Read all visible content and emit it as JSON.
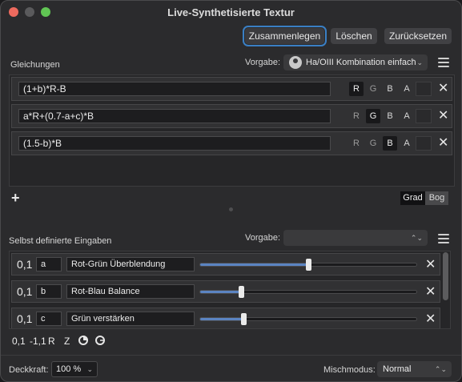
{
  "window": {
    "title": "Live-Synthetisierte Textur"
  },
  "toolbar": {
    "merge_label": "Zusammenlegen",
    "delete_label": "Löschen",
    "reset_label": "Zurücksetzen"
  },
  "equations": {
    "section_label": "Gleichungen",
    "preset_label": "Vorgabe:",
    "preset_value": "Ha/OIII Kombination einfach",
    "channel_labels": [
      "R",
      "G",
      "B",
      "A"
    ],
    "rows": [
      {
        "formula": "(1+b)*R-B",
        "active_channel": "R"
      },
      {
        "formula": "a*R+(0.7-a+c)*B",
        "active_channel": "G"
      },
      {
        "formula": "(1.5-b)*B",
        "active_channel": "B"
      }
    ],
    "angle_units": {
      "degree": "Grad",
      "radian": "Bog",
      "selected": "Grad"
    }
  },
  "inputs": {
    "section_label": "Selbst definierte Eingaben",
    "preset_label": "Vorgabe:",
    "preset_value": "",
    "rows": [
      {
        "value": "0,1",
        "var": "a",
        "name": "Rot-Grün Überblendung",
        "level": 0.5
      },
      {
        "value": "0,1",
        "var": "b",
        "name": "Rot-Blau Balance",
        "level": 0.19
      },
      {
        "value": "0,1",
        "var": "c",
        "name": "Grün verstärken",
        "level": 0.2
      }
    ],
    "add_tools": {
      "unit": "0,1",
      "signed": "-1,1",
      "rotation": "R",
      "zoom": "Z"
    }
  },
  "footer": {
    "opacity_label": "Deckkraft:",
    "opacity_value": "100 %",
    "blend_label": "Mischmodus:",
    "blend_value": "Normal"
  },
  "icons": {
    "preset": "preset-circle-icon",
    "menu": "hamburger-menu-icon",
    "delete": "close-x-icon",
    "add": "plus-icon",
    "chevron": "chevron-updown-icon"
  },
  "colors": {
    "accent": "#3a7fc4",
    "slider_fill": "#5b84c2"
  }
}
